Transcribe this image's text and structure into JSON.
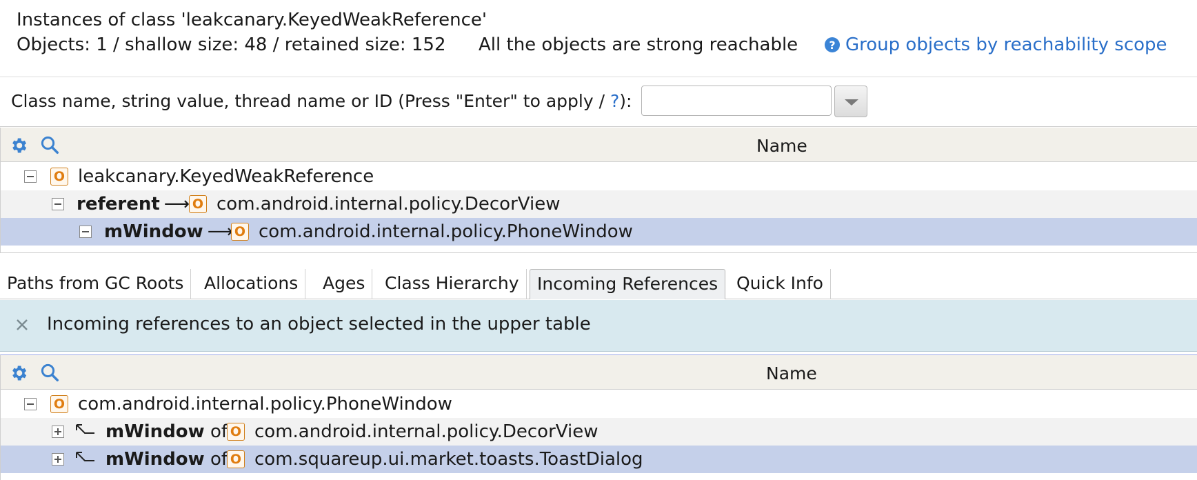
{
  "header": {
    "title": "Instances of class 'leakcanary.KeyedWeakReference'",
    "stats": "Objects: 1 / shallow size: 48 / retained size: 152",
    "reachability": "All the objects are strong reachable",
    "group_link": "Group objects by reachability scope",
    "help_glyph": "?"
  },
  "filter": {
    "label": "Class name, string value, thread name or ID  (Press \"Enter\" to apply / ",
    "help_link": "?",
    "label_end": "):",
    "value": "",
    "placeholder": ""
  },
  "upper_table": {
    "column": "Name",
    "rows": [
      {
        "field": "",
        "arrow": "",
        "icon": "O",
        "class": "leakcanary.KeyedWeakReference"
      },
      {
        "field": "referent",
        "arrow": "⟶",
        "icon": "O",
        "class": "com.android.internal.policy.DecorView"
      },
      {
        "field": "mWindow",
        "arrow": "⟶",
        "icon": "O",
        "class": "com.android.internal.policy.PhoneWindow"
      }
    ]
  },
  "tabs": [
    {
      "label": "Paths from GC Roots"
    },
    {
      "label": "Allocations"
    },
    {
      "label": "Ages"
    },
    {
      "label": "Class Hierarchy"
    },
    {
      "label": "Incoming References"
    },
    {
      "label": "Quick Info"
    }
  ],
  "banner": {
    "text": "Incoming references to an object selected in the upper table"
  },
  "lower_table": {
    "column": "Name",
    "rows": [
      {
        "field": "",
        "of": "",
        "icon": "O",
        "class": "com.android.internal.policy.PhoneWindow"
      },
      {
        "field": "mWindow",
        "of": "of",
        "icon": "O",
        "class": "com.android.internal.policy.DecorView"
      },
      {
        "field": "mWindow",
        "of": "of",
        "icon": "O",
        "class": "com.squareup.ui.market.toasts.ToastDialog"
      }
    ]
  },
  "colors": {
    "accent_link": "#2a6fc9",
    "selection": "#c5d0ea",
    "banner_bg": "#d8e9ef",
    "object_icon": "#e07d10",
    "header_bg": "#f2f0ea"
  },
  "icons": {
    "settings": "gear-icon",
    "search": "search-icon",
    "help": "question-circle-icon",
    "close": "close-icon",
    "object": "object-o-icon",
    "incoming": "back-arrow-icon"
  }
}
